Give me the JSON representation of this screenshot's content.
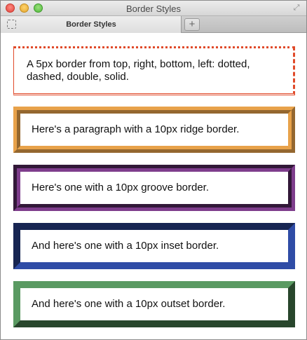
{
  "window": {
    "title": "Border Styles"
  },
  "tabs": {
    "active_label": "Border Styles",
    "new_tab_label": "+"
  },
  "paragraphs": [
    "A 5px border from top, right, bottom, left: dotted, dashed, double, solid.",
    "Here's a paragraph with a 10px ridge border.",
    "Here's one with a 10px groove border.",
    "And here's one with a 10px inset border.",
    "And here's one with a 10px outset border."
  ],
  "colors": {
    "multi_style": "#e04a2a",
    "ridge": "#e8a24a",
    "groove": "#7e3d8c",
    "inset": "#2f4ca6",
    "outset": "#5a9a62"
  }
}
